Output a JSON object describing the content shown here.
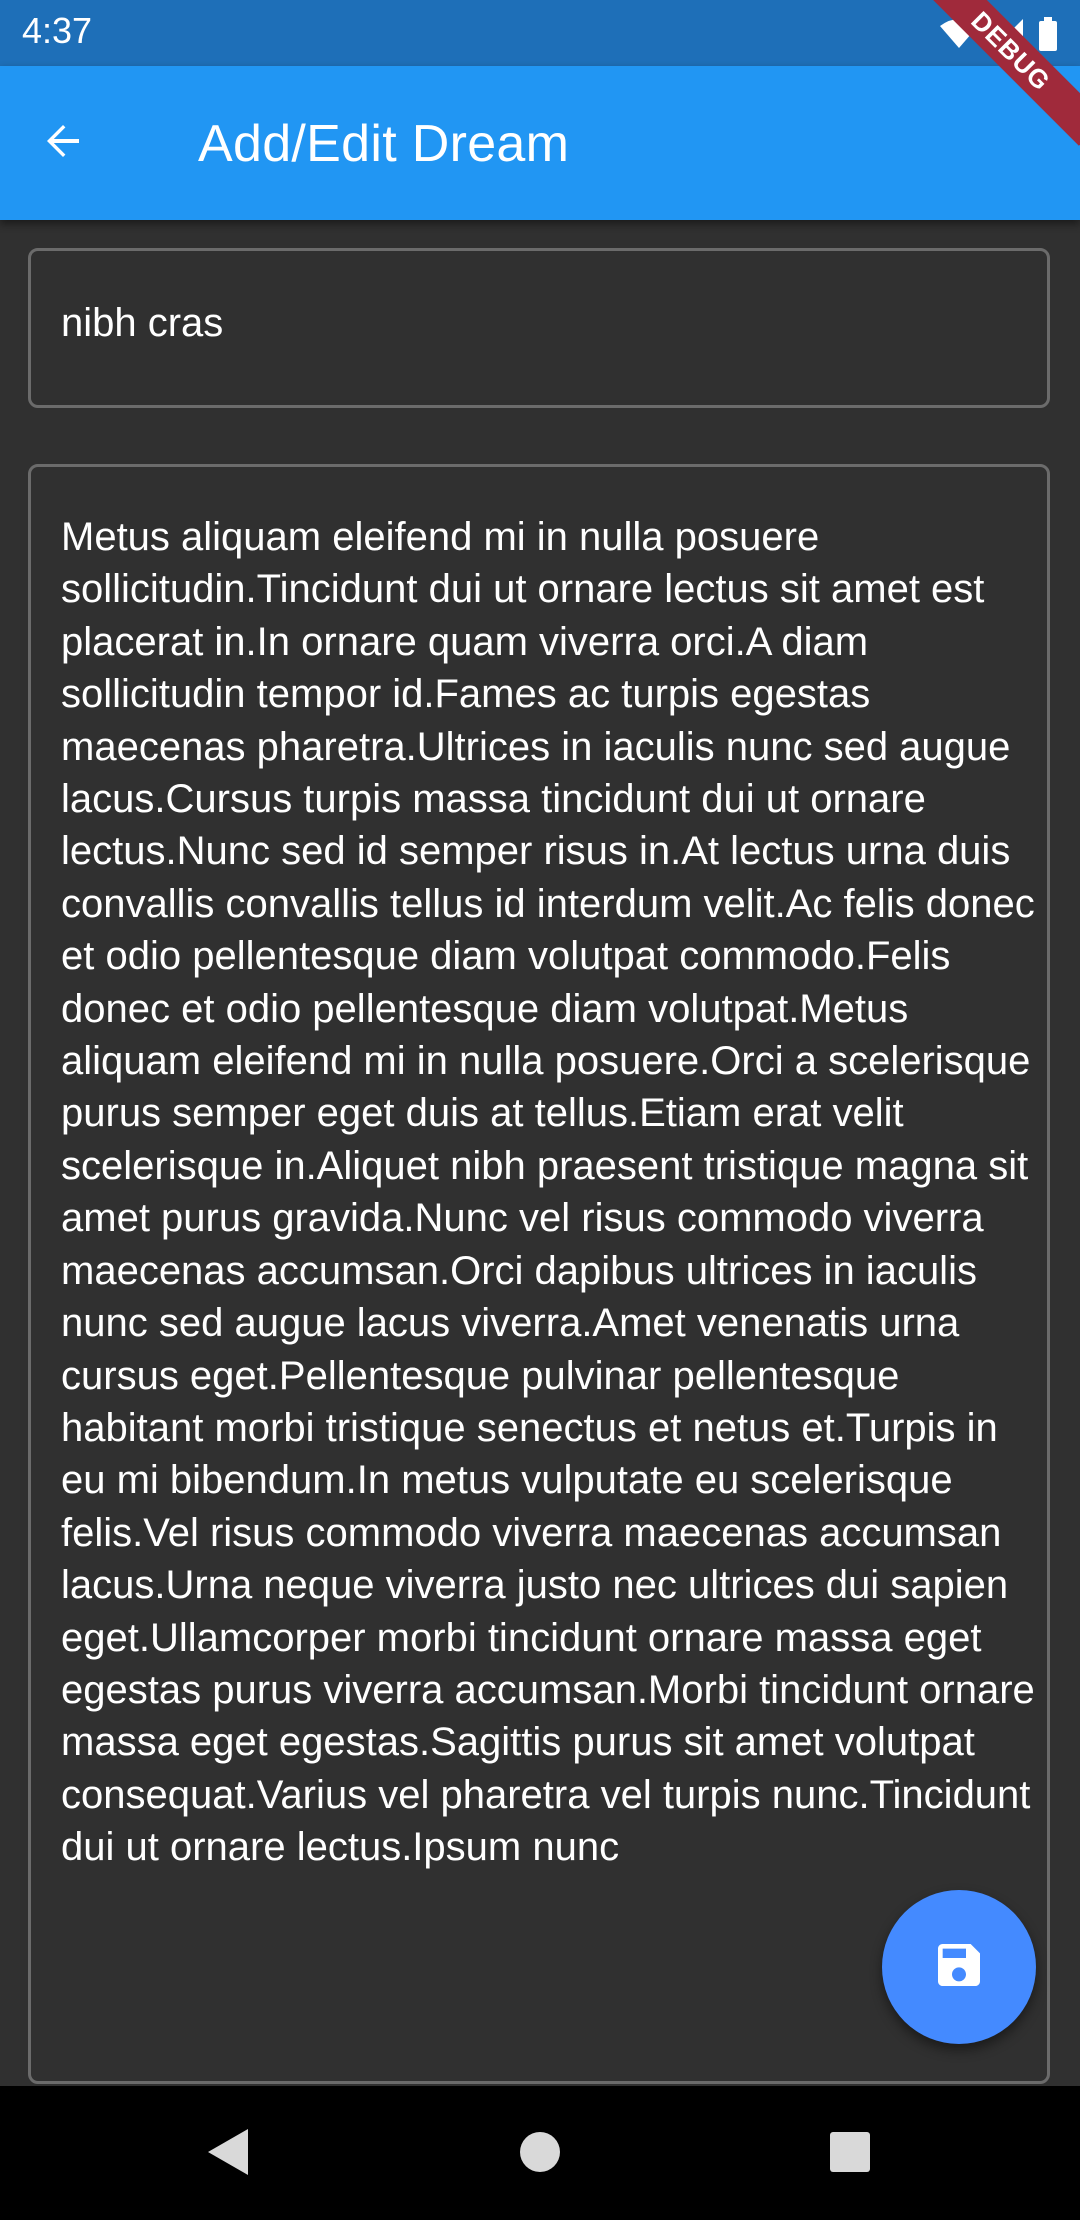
{
  "status_bar": {
    "time": "4:37",
    "icons": [
      "wifi-icon",
      "signal-icon",
      "battery-icon"
    ]
  },
  "debug_banner": {
    "label": "DEBUG"
  },
  "app_bar": {
    "title": "Add/Edit Dream",
    "back_icon": "arrow-back-icon",
    "background": "#2196f3"
  },
  "form": {
    "title_value": "nibh cras",
    "description_value": "Metus aliquam eleifend mi in nulla posuere sollicitudin.Tincidunt dui ut ornare lectus sit amet est placerat in.In ornare quam viverra orci.A diam sollicitudin tempor id.Fames ac turpis egestas maecenas pharetra.Ultrices in iaculis nunc sed augue lacus.Cursus turpis massa tincidunt dui ut ornare lectus.Nunc sed id semper risus in.At lectus urna duis convallis convallis tellus id interdum velit.Ac felis donec et odio pellentesque diam volutpat commodo.Felis donec et odio pellentesque diam volutpat.Metus aliquam eleifend mi in nulla posuere.Orci a scelerisque purus semper eget duis at tellus.Etiam erat velit scelerisque in.Aliquet nibh praesent tristique magna sit amet purus gravida.Nunc vel risus commodo viverra maecenas accumsan.Orci dapibus ultrices in iaculis nunc sed augue lacus viverra.Amet venenatis urna cursus eget.Pellentesque pulvinar pellentesque habitant morbi tristique senectus et netus et.Turpis in eu mi bibendum.In metus vulputate eu scelerisque felis.Vel risus commodo viverra maecenas accumsan lacus.Urna neque viverra justo nec ultrices dui sapien eget.Ullamcorper morbi tincidunt ornare massa eget egestas purus viverra accumsan.Morbi tincidunt ornare massa eget egestas.Sagittis purus sit amet volutpat consequat.Varius vel pharetra vel turpis nunc.Tincidunt dui ut ornare lectus.Ipsum nunc"
  },
  "fab": {
    "icon": "save-icon",
    "color": "#448aff"
  },
  "nav_bar": {
    "buttons": [
      "back-triangle-icon",
      "home-circle-icon",
      "recents-square-icon"
    ]
  },
  "colors": {
    "background": "#303030",
    "field_border": "#6b6b6b",
    "debug_ribbon": "#a02a3b"
  }
}
